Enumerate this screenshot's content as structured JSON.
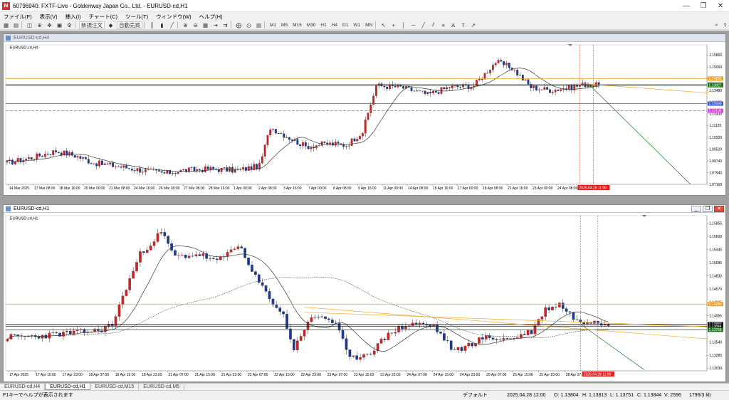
{
  "window": {
    "title": "60796940: FXTF-Live - Goldenway Japan Co., Ltd. - EURUSD-cd,H1",
    "controls": [
      "—",
      "❐",
      "✕"
    ]
  },
  "menu": [
    "ファイル(F)",
    "表示(V)",
    "挿入(I)",
    "チャート(C)",
    "ツール(T)",
    "ウィンドウ(W)",
    "ヘルプ(H)"
  ],
  "toolbar": {
    "new_order": "新規注文",
    "auto_trade": "自動売買",
    "timeframes": [
      "M1",
      "M5",
      "M15",
      "M30",
      "H1",
      "H4",
      "D1",
      "W1",
      "MN"
    ]
  },
  "chart_data": [
    {
      "type": "candlestick",
      "window_title": "EURUSD-cd,H4",
      "label": "EURUSD-cd,H4",
      "y_ticks": [
        "1.15860",
        "1.15060",
        "1.14260",
        "1.13480",
        "1.12680",
        "1.11900",
        "1.11120",
        "1.10320",
        "1.09520",
        "1.08740",
        "1.07940",
        "1.07160"
      ],
      "ylim": [
        1.0716,
        1.1626
      ],
      "x_ticks": [
        "14 Mar 2025",
        "17 Mar 08:00",
        "18 Mar 16:00",
        "20 Mar 00:00",
        "21 Mar 08:00",
        "24 Mar 16:00",
        "26 Mar 00:00",
        "27 Mar 08:00",
        "28 Mar 16:00",
        "1 Apr 00:00",
        "2 Apr 08:00",
        "3 Apr 16:00",
        "7 Apr 00:00",
        "8 Apr 08:00",
        "9 Apr 16:00",
        "11 Apr 00:00",
        "14 Apr 08:00",
        "15 Apr 16:00",
        "17 Apr 00:00",
        "18 Apr 08:00",
        "21 Apr 16:00",
        "23 Apr 00:00",
        "24 Apr 08:00",
        "25 Apr 16:00"
      ],
      "price_labels": [
        {
          "value": 1.1428,
          "text": "1.14280",
          "color": "#f7a21b"
        },
        {
          "value": 1.1386,
          "text": "1.13860",
          "color": "#111111"
        },
        {
          "value": 1.1383,
          "text": "1.13827",
          "color": "#1a7a1a"
        },
        {
          "value": 1.1259,
          "text": "1.12590",
          "color": "#3a5bd9"
        },
        {
          "value": 1.1211,
          "text": "1.12110",
          "color": "#e040e0"
        }
      ],
      "time_label": "2025.04.28 11:00",
      "path": [
        {
          "i": 0,
          "p": 1.086
        },
        {
          "i": 10,
          "p": 1.09
        },
        {
          "i": 18,
          "p": 1.094
        },
        {
          "i": 25,
          "p": 1.091
        },
        {
          "i": 32,
          "p": 1.086
        },
        {
          "i": 40,
          "p": 1.084
        },
        {
          "i": 50,
          "p": 1.081
        },
        {
          "i": 58,
          "p": 1.079
        },
        {
          "i": 65,
          "p": 1.081
        },
        {
          "i": 75,
          "p": 1.082
        },
        {
          "i": 85,
          "p": 1.081
        },
        {
          "i": 93,
          "p": 1.084
        },
        {
          "i": 97,
          "p": 1.11
        },
        {
          "i": 103,
          "p": 1.104
        },
        {
          "i": 110,
          "p": 1.097
        },
        {
          "i": 118,
          "p": 1.099
        },
        {
          "i": 125,
          "p": 1.098
        },
        {
          "i": 131,
          "p": 1.107
        },
        {
          "i": 136,
          "p": 1.138
        },
        {
          "i": 145,
          "p": 1.137
        },
        {
          "i": 155,
          "p": 1.132
        },
        {
          "i": 163,
          "p": 1.137
        },
        {
          "i": 172,
          "p": 1.138
        },
        {
          "i": 180,
          "p": 1.154
        },
        {
          "i": 186,
          "p": 1.15
        },
        {
          "i": 193,
          "p": 1.137
        },
        {
          "i": 200,
          "p": 1.135
        },
        {
          "i": 208,
          "p": 1.137
        },
        {
          "i": 213,
          "p": 1.139
        },
        {
          "i": 218,
          "p": 1.138
        }
      ]
    },
    {
      "type": "candlestick",
      "window_title": "EURUSD-cd,H1",
      "label": "EURUSD-cd,H1",
      "y_ticks": [
        "1.15855",
        "1.15600",
        "1.15345",
        "1.15085",
        "1.14830",
        "1.14570",
        "1.14315",
        "1.14055",
        "1.13800",
        "1.13540",
        "1.13280",
        "1.13030"
      ],
      "ylim": [
        1.1298,
        1.1592
      ],
      "x_ticks": [
        "17 Apr 2025",
        "17 Apr 15:00",
        "17 Apr 23:00",
        "18 Apr 07:00",
        "18 Apr 15:00",
        "18 Apr 23:00",
        "21 Apr 07:00",
        "21 Apr 15:00",
        "21 Apr 23:00",
        "22 Apr 07:00",
        "22 Apr 15:00",
        "22 Apr 23:00",
        "23 Apr 07:00",
        "23 Apr 15:00",
        "23 Apr 23:00",
        "24 Apr 07:00",
        "24 Apr 15:00",
        "24 Apr 23:00",
        "25 Apr 07:00",
        "25 Apr 15:00",
        "25 Apr 23:00",
        "28 Apr 07:00",
        "28 Apr 15:00"
      ],
      "price_labels": [
        {
          "value": 1.1428,
          "text": "1.14280",
          "color": "#f7a21b"
        },
        {
          "value": 1.1389,
          "text": "1.13880",
          "color": "#111111"
        },
        {
          "value": 1.1385,
          "text": "1.13844",
          "color": "#111111"
        },
        {
          "value": 1.1378,
          "text": "1.13768",
          "color": "#1a7a1a"
        }
      ],
      "time_label": "2025.04.28 11:00",
      "path": [
        {
          "i": 0,
          "p": 1.1364
        },
        {
          "i": 8,
          "p": 1.1365
        },
        {
          "i": 18,
          "p": 1.1372
        },
        {
          "i": 26,
          "p": 1.1376
        },
        {
          "i": 30,
          "p": 1.1388
        },
        {
          "i": 34,
          "p": 1.146
        },
        {
          "i": 38,
          "p": 1.1525
        },
        {
          "i": 44,
          "p": 1.1568
        },
        {
          "i": 48,
          "p": 1.152
        },
        {
          "i": 55,
          "p": 1.1525
        },
        {
          "i": 60,
          "p": 1.151
        },
        {
          "i": 66,
          "p": 1.1545
        },
        {
          "i": 70,
          "p": 1.149
        },
        {
          "i": 75,
          "p": 1.144
        },
        {
          "i": 79,
          "p": 1.1405
        },
        {
          "i": 82,
          "p": 1.134
        },
        {
          "i": 86,
          "p": 1.1395
        },
        {
          "i": 90,
          "p": 1.1405
        },
        {
          "i": 94,
          "p": 1.139
        },
        {
          "i": 98,
          "p": 1.132
        },
        {
          "i": 104,
          "p": 1.1335
        },
        {
          "i": 110,
          "p": 1.1375
        },
        {
          "i": 116,
          "p": 1.139
        },
        {
          "i": 122,
          "p": 1.1385
        },
        {
          "i": 128,
          "p": 1.1335
        },
        {
          "i": 136,
          "p": 1.1362
        },
        {
          "i": 144,
          "p": 1.136
        },
        {
          "i": 150,
          "p": 1.1375
        },
        {
          "i": 154,
          "p": 1.1418
        },
        {
          "i": 158,
          "p": 1.1428
        },
        {
          "i": 164,
          "p": 1.139
        },
        {
          "i": 168,
          "p": 1.1398
        },
        {
          "i": 172,
          "p": 1.1386
        }
      ]
    }
  ],
  "tabs": [
    "EURUSD-cd,H4",
    "EURUSD-cd,H1",
    "EURUSD-cd,M15",
    "EURUSD-cd,M5"
  ],
  "active_tab": 1,
  "status": {
    "help": "F1キーでヘルプが表示されます",
    "profile": "デフォルト",
    "time": "2025.04.28 12:00",
    "open": "O: 1.13804",
    "high": "H: 1.13813",
    "low": "L: 1.13751",
    "close": "C: 1.13844",
    "volume": "V: 2596",
    "traffic": "1796/3 kb"
  }
}
